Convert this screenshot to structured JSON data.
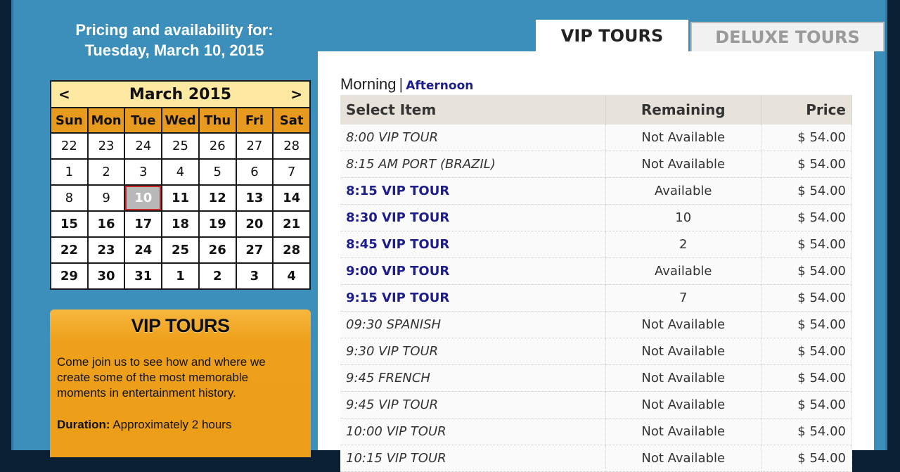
{
  "heading": {
    "line1": "Pricing and availability for:",
    "line2": "Tuesday, March 10, 2015"
  },
  "calendar": {
    "prev": "<",
    "next": ">",
    "title": "March 2015",
    "weekdays": [
      "Sun",
      "Mon",
      "Tue",
      "Wed",
      "Thu",
      "Fri",
      "Sat"
    ],
    "weeks": [
      [
        "22",
        "23",
        "24",
        "25",
        "26",
        "27",
        "28"
      ],
      [
        "1",
        "2",
        "3",
        "4",
        "5",
        "6",
        "7"
      ],
      [
        "8",
        "9",
        "10",
        "11",
        "12",
        "13",
        "14"
      ],
      [
        "15",
        "16",
        "17",
        "18",
        "19",
        "20",
        "21"
      ],
      [
        "22",
        "23",
        "24",
        "25",
        "26",
        "27",
        "28"
      ],
      [
        "29",
        "30",
        "31",
        "1",
        "2",
        "3",
        "4"
      ]
    ],
    "selected": "10"
  },
  "promo": {
    "title": "VIP TOURS",
    "text": "Come join us to see how and where we create some of the most memorable moments in entertainment history.",
    "duration_label": "Duration:",
    "duration_value": " Approximately 2 hours"
  },
  "tabs": [
    {
      "label": "VIP TOURS",
      "active": true
    },
    {
      "label": "DELUXE TOURS",
      "active": false
    }
  ],
  "daypart": {
    "current": "Morning",
    "separator": "|",
    "other": "Afternoon"
  },
  "table": {
    "headers": {
      "item": "Select Item",
      "remaining": "Remaining",
      "price": "Price"
    },
    "rows": [
      {
        "item": "8:00 VIP TOUR",
        "remaining": "Not Available",
        "price": "$ 54.00",
        "available": false
      },
      {
        "item": "8:15 AM PORT (BRAZIL)",
        "remaining": "Not Available",
        "price": "$ 54.00",
        "available": false
      },
      {
        "item": "8:15 VIP TOUR",
        "remaining": "Available",
        "price": "$ 54.00",
        "available": true
      },
      {
        "item": "8:30 VIP TOUR",
        "remaining": "10",
        "price": "$ 54.00",
        "available": true
      },
      {
        "item": "8:45 VIP TOUR",
        "remaining": "2",
        "price": "$ 54.00",
        "available": true
      },
      {
        "item": "9:00 VIP TOUR",
        "remaining": "Available",
        "price": "$ 54.00",
        "available": true
      },
      {
        "item": "9:15 VIP TOUR",
        "remaining": "7",
        "price": "$ 54.00",
        "available": true
      },
      {
        "item": "09:30 SPANISH",
        "remaining": "Not Available",
        "price": "$ 54.00",
        "available": false
      },
      {
        "item": "9:30 VIP TOUR",
        "remaining": "Not Available",
        "price": "$ 54.00",
        "available": false
      },
      {
        "item": "9:45 FRENCH",
        "remaining": "Not Available",
        "price": "$ 54.00",
        "available": false
      },
      {
        "item": "9:45 VIP TOUR",
        "remaining": "Not Available",
        "price": "$ 54.00",
        "available": false
      },
      {
        "item": "10:00 VIP TOUR",
        "remaining": "Not Available",
        "price": "$ 54.00",
        "available": false
      },
      {
        "item": "10:15 VIP TOUR",
        "remaining": "Not Available",
        "price": "$ 54.00",
        "available": false
      }
    ]
  },
  "colors": {
    "background": "#3d8fbb",
    "calendar_header": "#fde9a2",
    "weekday_bar": "#e89a1f",
    "promo_orange": "#eea01a",
    "link_blue": "#1d1d8c",
    "selected_border": "#c62828"
  }
}
